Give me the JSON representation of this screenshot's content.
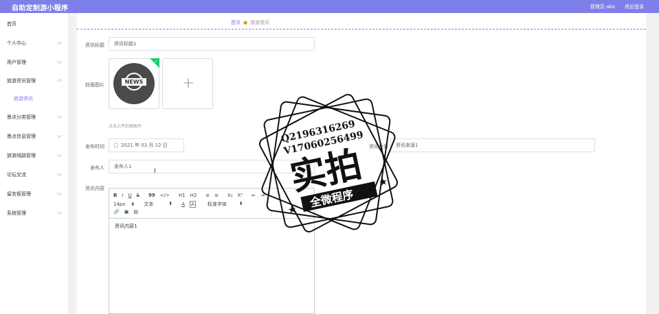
{
  "app": {
    "title": "自助定制游小程序"
  },
  "header": {
    "user_label": "管理员 abo",
    "logout_label": "退出登录"
  },
  "sidebar": {
    "items": [
      {
        "label": "首页",
        "has_chevron": false
      },
      {
        "label": "个人中心",
        "has_chevron": true
      },
      {
        "label": "用户管理",
        "has_chevron": true
      },
      {
        "label": "旅游资讯管理",
        "has_chevron": true,
        "expanded": true
      },
      {
        "label": "景点分类管理",
        "has_chevron": true
      },
      {
        "label": "景点信息管理",
        "has_chevron": true
      },
      {
        "label": "旅游线路管理",
        "has_chevron": true
      },
      {
        "label": "论坛交流",
        "has_chevron": true
      },
      {
        "label": "留言板管理",
        "has_chevron": true
      },
      {
        "label": "系统管理",
        "has_chevron": true
      }
    ],
    "sub_item": "旅游资讯"
  },
  "breadcrumb": {
    "home": "首页",
    "current": "旅游资讯"
  },
  "form": {
    "title_label": "资讯标题",
    "title_value": "资讯标题1",
    "cover_label": "封面图片",
    "cover_image_text": "NEWS",
    "cover_hint": "点击上传封面图片",
    "publish_time_label": "发布时间",
    "publish_time_value": "2021 年 03 月 12 日",
    "source_label": "资讯来源",
    "source_value": "资讯来源1",
    "publisher_label": "发布人",
    "publisher_value": "发布人1",
    "content_label": "资讯内容"
  },
  "editor": {
    "row1": [
      "B",
      "I",
      "U",
      "S",
      "99",
      "</>",
      "H1",
      "H2",
      "≡",
      "≡",
      "X₂",
      "X²",
      "⇤",
      "⇥"
    ],
    "font_size": "14px",
    "text_type": "文本",
    "font_family": "标准字体",
    "body": "资讯内容1"
  },
  "stamp": {
    "line1": "Q2196316269",
    "line2": "V17060256499",
    "big": "实拍",
    "banner": "全微程序"
  },
  "colors": {
    "accent": "#7e7fe8",
    "success": "#13ce66"
  }
}
